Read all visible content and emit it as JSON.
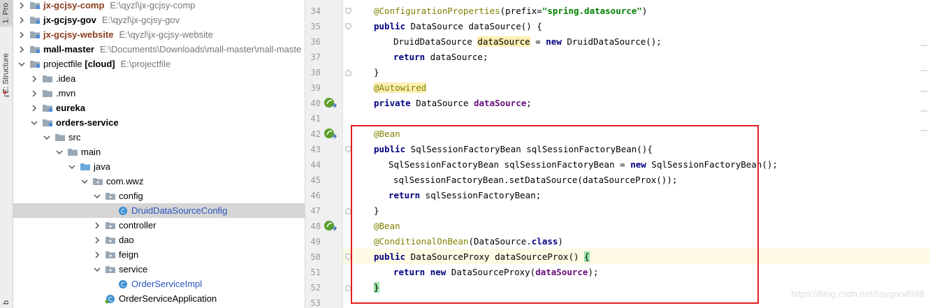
{
  "sidebar": {
    "project_tab": "1: Pro",
    "structure_tab": "Z: Structure",
    "bottom_tab": "b"
  },
  "tree": {
    "rows": [
      {
        "name": "jx-gcjsy-comp",
        "path": "E:\\qyzl\\jx-gcjsy-comp"
      },
      {
        "name": "jx-gcjsy-gov",
        "path": "E:\\qyzl\\jx-gcjsy-gov"
      },
      {
        "name": "jx-gcjsy-website",
        "path": "E:\\qyzl\\jx-gcjsy-website"
      },
      {
        "name": "mall-master",
        "path": "E:\\Documents\\Downloads\\mall-master\\mall-maste"
      },
      {
        "name": "projectfile",
        "tag": "[cloud]",
        "path": "E:\\projectfile"
      },
      {
        "name": ".idea"
      },
      {
        "name": ".mvn"
      },
      {
        "name": "eureka"
      },
      {
        "name": "orders-service"
      },
      {
        "name": "src"
      },
      {
        "name": "main"
      },
      {
        "name": "java"
      },
      {
        "name": "com.wwz"
      },
      {
        "name": "config"
      },
      {
        "name": "DruidDataSourceConfig"
      },
      {
        "name": "controller"
      },
      {
        "name": "dao"
      },
      {
        "name": "feign"
      },
      {
        "name": "service"
      },
      {
        "name": "OrderServiceImpl"
      },
      {
        "name": "OrderServiceApplication"
      }
    ]
  },
  "editor": {
    "line_numbers": [
      "34",
      "35",
      "36",
      "37",
      "38",
      "39",
      "40",
      "41",
      "42",
      "43",
      "44",
      "45",
      "46",
      "47",
      "48",
      "49",
      "50",
      "51",
      "52",
      "53"
    ],
    "code": {
      "l34_ann": "@ConfigurationProperties",
      "l34_p1": "(prefix=",
      "l34_str": "\"spring.datasource\"",
      "l34_p2": ")",
      "l35_kw": "public",
      "l35_rest": " DataSource dataSource() {",
      "l36_a": "DruidDataSource ",
      "l36_hl": "dataSource",
      "l36_b": " = ",
      "l36_kw": "new",
      "l36_c": " DruidDataSource();",
      "l37_kw": "return",
      "l37_rest": " dataSource;",
      "l38": "}",
      "l39_ann": "@Autowired",
      "l40_kw": "private",
      "l40_a": " DataSource ",
      "l40_fld": "dataSource",
      "l40_b": ";",
      "l42_ann": "@Bean",
      "l43_kw": "public",
      "l43_rest": " SqlSessionFactoryBean sqlSessionFactoryBean(){",
      "l44_a": "SqlSessionFactoryBean sqlSessionFactoryBean = ",
      "l44_kw": "new",
      "l44_b": " SqlSessionFactoryBean();",
      "l45": "sqlSessionFactoryBean.setDataSource(dataSourceProx());",
      "l46_kw": "return",
      "l46_rest": " sqlSessionFactoryBean;",
      "l47": "}",
      "l48_ann": "@Bean",
      "l49_ann": "@ConditionalOnBean",
      "l49_a": "(DataSource.",
      "l49_kw": "class",
      "l49_b": ")",
      "l50_kw": "public",
      "l50_rest": " DataSourceProxy dataSourceProx() ",
      "l50_brk": "{",
      "l51_kw1": "return",
      "l51_sp": " ",
      "l51_kw2": "new",
      "l51_a": " DataSourceProxy(",
      "l51_fld": "dataSource",
      "l51_b": ");",
      "l52_brk": "}"
    }
  },
  "watermark": "https://blog.csdn.net/saygood999",
  "colors": {
    "annotation": "#808000",
    "keyword": "#000080",
    "field": "#660e7a",
    "string": "#008000",
    "red_box": "#e02020"
  }
}
